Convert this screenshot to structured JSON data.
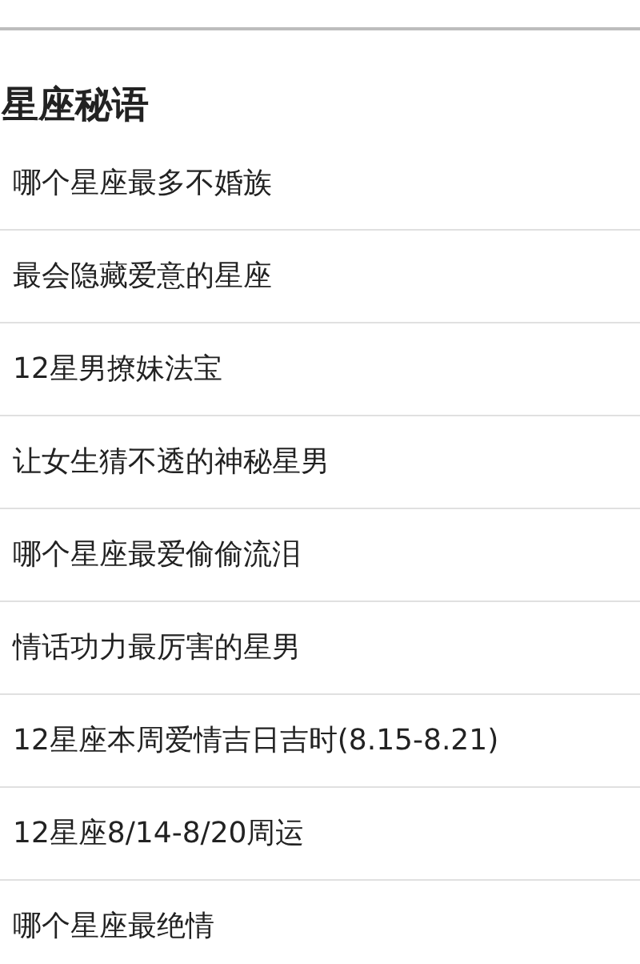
{
  "title": "星座秘语",
  "items": [
    {
      "label": "哪个星座最多不婚族"
    },
    {
      "label": "最会隐藏爱意的星座"
    },
    {
      "label": "12星男撩妹法宝"
    },
    {
      "label": "让女生猜不透的神秘星男"
    },
    {
      "label": "哪个星座最爱偷偷流泪"
    },
    {
      "label": "情话功力最厉害的星男"
    },
    {
      "label": "12星座本周爱情吉日吉时(8.15-8.21)"
    },
    {
      "label": "12星座8/14-8/20周运"
    },
    {
      "label": "哪个星座最绝情"
    }
  ]
}
